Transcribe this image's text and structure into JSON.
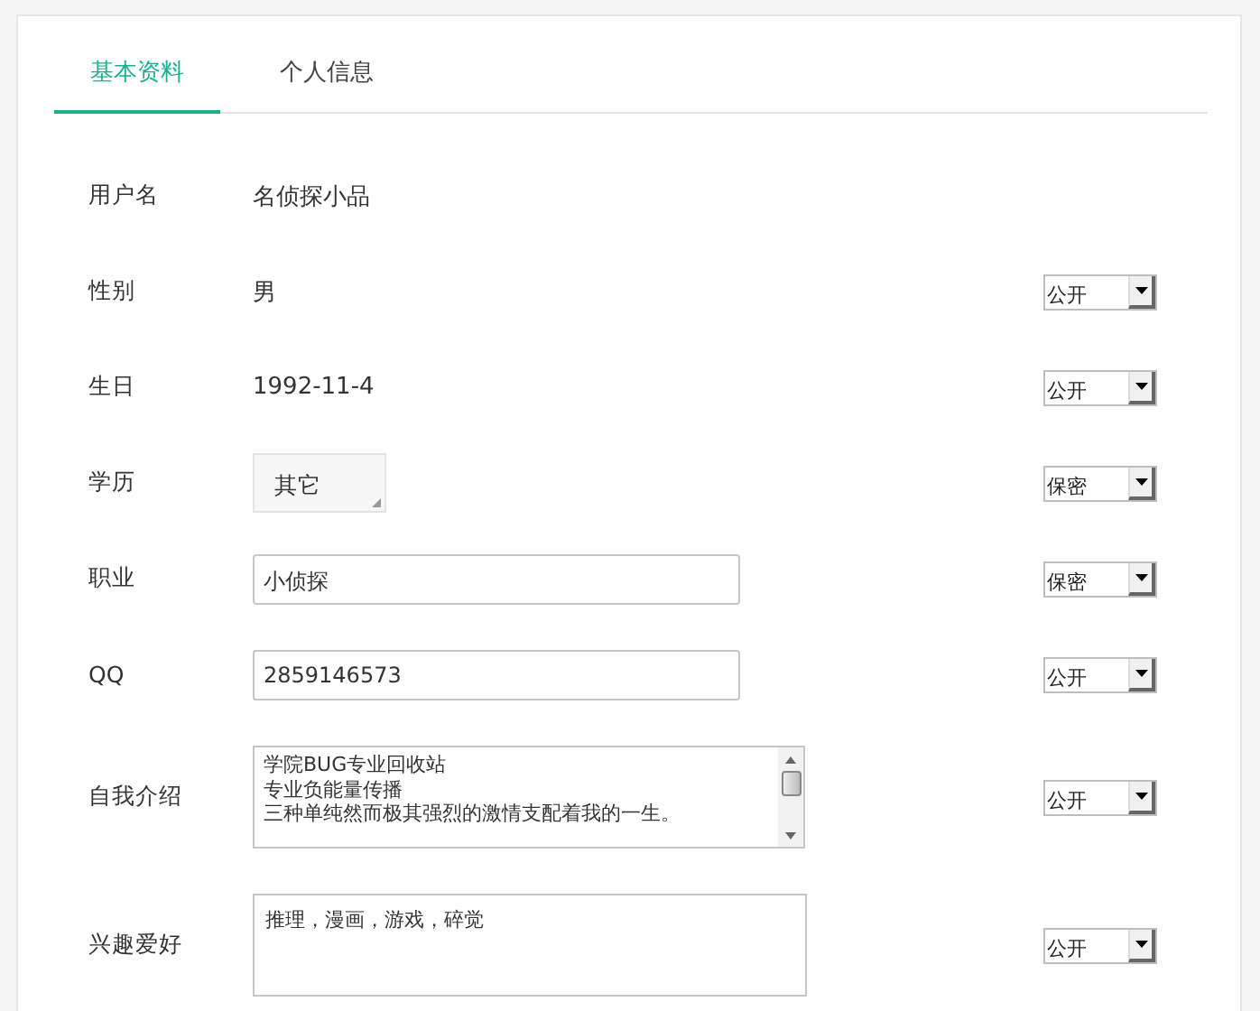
{
  "tabs": [
    {
      "label": "基本资料",
      "selected": true
    },
    {
      "label": "个人信息",
      "selected": false
    }
  ],
  "fields": [
    {
      "label": "用户名",
      "kind": "static",
      "value": "名侦探小品"
    },
    {
      "label": "性别",
      "kind": "static",
      "value": "男",
      "privacy": "公开"
    },
    {
      "label": "生日",
      "kind": "static",
      "value": "1992-11-4",
      "privacy": "公开"
    },
    {
      "label": "学历",
      "kind": "choice",
      "value": "其它",
      "privacy": "保密"
    },
    {
      "label": "职业",
      "kind": "input",
      "value": "小侦探",
      "privacy": "保密"
    },
    {
      "label": "QQ",
      "kind": "input",
      "value": "2859146573",
      "privacy": "公开"
    },
    {
      "label": "自我介绍",
      "kind": "scrolltext",
      "lines": [
        "学院BUG专业回收站",
        "专业负能量传播",
        "三种单纯然而极其强烈的激情支配着我的一生。"
      ],
      "privacy": "公开"
    },
    {
      "label": "兴趣爱好",
      "kind": "textarea",
      "value": "推理，漫画，游戏，碎觉",
      "privacy": "公开"
    }
  ]
}
